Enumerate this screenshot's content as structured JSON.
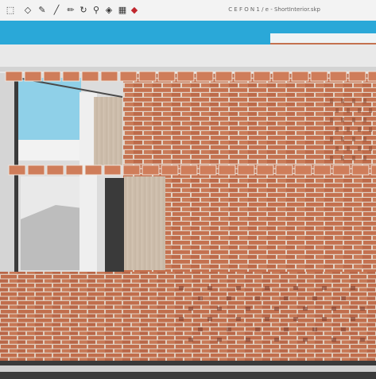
{
  "toolbar": {
    "tools": [
      {
        "name": "select-icon",
        "glyph": "⬚"
      },
      {
        "name": "eraser-icon",
        "glyph": "◇"
      },
      {
        "name": "paint-bucket-icon",
        "glyph": "✎"
      },
      {
        "name": "line-icon",
        "glyph": "╱"
      },
      {
        "name": "pencil-icon",
        "glyph": "✏"
      },
      {
        "name": "orbit-icon",
        "glyph": "↻"
      },
      {
        "name": "zoom-icon",
        "glyph": "⚲"
      },
      {
        "name": "scenes-icon",
        "glyph": "◈"
      },
      {
        "name": "warehouse-icon",
        "glyph": "▦"
      },
      {
        "name": "ruby-icon",
        "glyph": "◆"
      }
    ],
    "document_title": "C E F O  N 1 / e  -  ShortInterior.skp"
  },
  "colors": {
    "brick": "#c4714f",
    "mortar": "#e3d2c4",
    "sky": "#2aa8d8",
    "wood": "#c8b8a6",
    "glass": "#8fd0e8"
  }
}
